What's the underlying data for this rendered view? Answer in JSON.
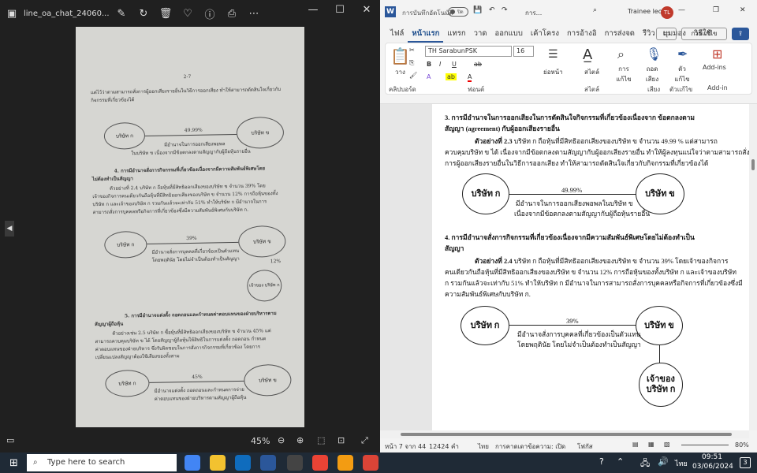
{
  "viewer": {
    "title": "line_oa_chat_24060...",
    "zoom": "45%",
    "photo": {
      "page_num": "2-7",
      "l1": "แต่ไว้ว่าตามสามารถสั่งการผู้ออกเสียงรายอื่นในวิธีการออกเสียง ทำให้สามารถตัดสินใจเกี่ยวกับ",
      "l2": "กิจกรรมที่เกี่ยวข้องได้",
      "c1a": "บริษัท ก",
      "c1b": "บริษัท ข",
      "p1": "49.99%",
      "cap1a": "มีอำนาจในการออกเสียงพอพล",
      "cap1b": "ในบริษัท ข เนื่องจากมีข้อตกลงตามสัญญากับผู้ถือหุ้นรายอื่น",
      "h4": "4. การมีอำนาจสั่งการกิจกรรมที่เกี่ยวข้องเนื่องจากมีความสัมพันธ์พิเศษโดย",
      "h4b": "ไม่ต้องทำเป็นสัญญา",
      "t4a": "ตัวอย่างที่ 2.4 บริษัท ก ถือหุ้นที่มีสิทธิออกเสียงของบริษัท ข จำนวน 39% โดย",
      "t4b": "เจ้าของกิจการคนเดียวกันถือหุ้นที่มีสิทธิออกเสียงของบริษัท ข จำนวน 12% การถือหุ้นของทั้ง",
      "t4c": "บริษัท ก และเจ้าของบริษัท ก รวมกันแล้วจะเท่ากับ 51% ทำให้บริษัท ก มีอำนาจในการ",
      "t4d": "สามารถสั่งการบุคคลหรือกิจการที่เกี่ยวข้องซึ่งมีความสัมพันธ์พิเศษกับบริษัท ก.",
      "c2a": "บริษัท ก",
      "c2b": "บริษัท ข",
      "p2": "39%",
      "p2b": "12%",
      "cap2a": "มีอำนาจสั่งการบุคคลที่เกี่ยวข้องเป็นตัวแทน",
      "cap2b": "โดยพฤตินัย โดยไม่จำเป็นต้องทำเป็นสัญญา",
      "c2c": "เจ้าของ บริษัท ก",
      "h5": "5. การมีอำนาจแต่งตั้ง ถอดถอนและกำหนดค่าตอบแทนของฝ่ายบริหารตาม",
      "h5b": "สัญญาผู้ถือหุ้น",
      "t5a": "ตัวอย่างเช่น 2.5 บริษัท ก ซื้อหุ้นที่มีสิทธิออกเสียงของบริษัท ข จำนวน 45% แต่",
      "t5b": "สามารถควบคุมบริษัท ข ได้ โดยสัญญาผู้ถือหุ้นให้สิทธิในการแต่งตั้ง ถอดถอน กำหนด",
      "t5c": "ค่าตอบแทนของฝ่ายบริหาร ซึ่งรับผิดชอบในการสั่งการกิจกรรมที่เกี่ยวข้อง โดยการ",
      "t5d": "เปลี่ยนแปลงสัญญาต้องใช้เสียงของทั้งสาม",
      "c3a": "บริษัท ก",
      "c3b": "บริษัท ข",
      "p3": "45%",
      "cap3a": "มีอำนาจแต่งตั้ง ถอดถอนและกำหนดการจ่าย",
      "cap3b": "ค่าตอบแทนของฝ่ายบริหารตามสัญญาผู้ถือหุ้น"
    }
  },
  "word": {
    "autosave_label": "การบันทึกอัตโนมัติ",
    "autosave_state": "ปิด",
    "doc_title": "การ...",
    "user_name": "Trainee leo",
    "user_initials": "TL",
    "tabs": [
      "ไฟล์",
      "หน้าแรก",
      "แทรก",
      "วาด",
      "ออกแบบ",
      "เค้าโครง",
      "การอ้างอิ",
      "การส่งจด",
      "รีวิว",
      "มุมมอง",
      "วิธีใช้"
    ],
    "edit_btn": "การแก้ไข",
    "ribbon": {
      "paste": "วาง",
      "clipboard": "คลิปบอร์ด",
      "font_name": "TH SarabunPSK",
      "font_size": "16",
      "font_group": "ฟอนต์",
      "paragraph": "ย่อหน้า",
      "styles": "สไตล์",
      "styles_group": "สไตล์",
      "find": "การ แก้ไข",
      "dictate": "ถอด เสียง",
      "voice_group": "เสียง",
      "editor": "ตัว แก้ไข",
      "editor_group": "ตัวแก้ไข",
      "addins": "Add-ins",
      "addins_group": "Add-in"
    },
    "doc": {
      "h3": "3.  การมีอำนาจในการออกเสียงในการตัดสินใจกิจกรรมที่เกี่ยวข้องเนื่องจาก ข้อตกลงตาม",
      "h3b": "สัญญา (agreement) กับผู้ออกเสียงรายอื่น",
      "t3a": "ตัวอย่างที่ 2.3",
      "t3a2": " บริษัท ก ถือหุ้นที่มีสิทธิออกเสียงของบริษัท ข จำนวน 49.99 % แต่สามารถ",
      "t3b": "ควบคุมบริษัท ข ได้ เนื่องจากมีข้อตกลงตามสัญญากับผู้ออกเสียงรายอื่น ทำให้ผู้ลงทุนแน่ใจว่าตามสามารถสั่ง",
      "t3c": "การผู้ออกเสียงรายอื่นในวิธีการออกเสียง ทำให้สามารถตัดสินใจเกี่ยวกับกิจกรรมที่เกี่ยวข้องได้",
      "c1a": "บริษัท ก",
      "c1b": "บริษัท ข",
      "p1": "49.99%",
      "cap1a": "มีอำนาจในการออกเสียงพอพลในบริษัท ข",
      "cap1b": "เนื่องจากมีข้อตกลงตามสัญญากับผู้ถือหุ้นรายอื่น",
      "h4": "4.  การมีอำนาจสั่งการกิจกรรมที่เกี่ยวข้องเนื่องจากมีความสัมพันธ์พิเศษโดยไม่ต้องทำเป็น",
      "h4b": "สัญญา",
      "t4a": "ตัวอย่างที่ 2.4",
      "t4a2": " บริษัท ก ถือหุ้นที่มีสิทธิออกเสียงของบริษัท ข จำนวน 39% โดยเจ้าของกิจการ",
      "t4b": "คนเดียวกันถือหุ้นที่มีสิทธิออกเสียงของบริษัท ข จำนวน 12% การถือหุ้นของทั้งบริษัท ก และเจ้าของบริษัท",
      "t4c": "ก รวมกันแล้วจะเท่ากับ 51% ทำให้บริษัท ก มีอำนาจในการสามารถสั่งการบุคคลหรือกิจการที่เกี่ยวข้องซึ่งมี",
      "t4d": "ความสัมพันธ์พิเศษกับบริษัท ก.",
      "c2a": "บริษัท ก",
      "c2b": "บริษัท ข",
      "p2": "39%",
      "cap2a": "มีอำนาจสั่งการบุคคลที่เกี่ยวข้องเป็นตัวแทน",
      "cap2b": "โดยพฤตินัย โดยไม่จำเป็นต้องทำเป็นสัญญา",
      "c2c": "เจ้าของ บริษัท ก"
    },
    "status": {
      "page": "หน้า 7 จาก 44",
      "words": "12424 คำ",
      "lang": "ไทย",
      "focus": "การคาดเดาข้อความ: เปิด",
      "focus2": "โฟกัส",
      "zoom": "80%"
    }
  },
  "taskbar": {
    "search_placeholder": "Type here to search",
    "lang": "ไทย",
    "time": "09:51",
    "date": "03/06/2024",
    "notif": "3"
  }
}
